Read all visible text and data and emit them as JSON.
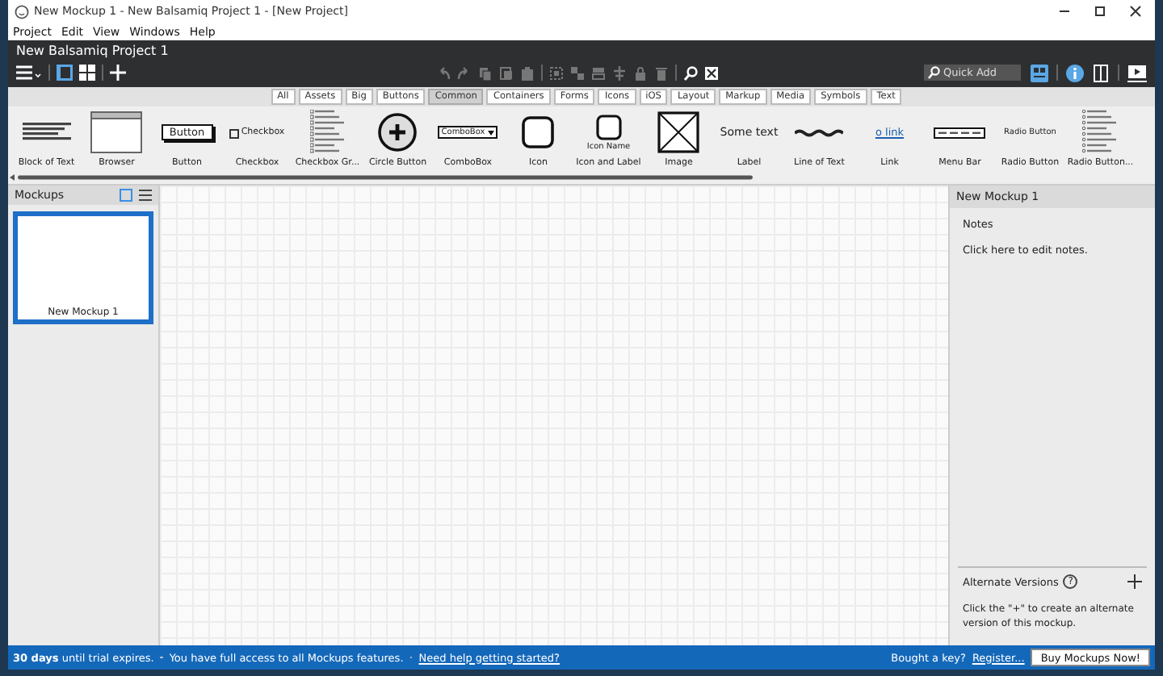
{
  "window": {
    "title": "New Mockup 1 - New Balsamiq Project 1 - [New Project]"
  },
  "menu": [
    "Project",
    "Edit",
    "View",
    "Windows",
    "Help"
  ],
  "project_title": "New Balsamiq Project 1",
  "quick_add": {
    "placeholder": "Quick Add"
  },
  "filter_tabs": [
    {
      "label": "All",
      "selected": false
    },
    {
      "label": "Assets",
      "selected": false
    },
    {
      "label": "Big",
      "selected": false
    },
    {
      "label": "Buttons",
      "selected": false
    },
    {
      "label": "Common",
      "selected": true
    },
    {
      "label": "Containers",
      "selected": false
    },
    {
      "label": "Forms",
      "selected": false
    },
    {
      "label": "Icons",
      "selected": false
    },
    {
      "label": "iOS",
      "selected": false
    },
    {
      "label": "Layout",
      "selected": false
    },
    {
      "label": "Markup",
      "selected": false
    },
    {
      "label": "Media",
      "selected": false
    },
    {
      "label": "Symbols",
      "selected": false
    },
    {
      "label": "Text",
      "selected": false
    }
  ],
  "components": [
    {
      "kind": "text-block",
      "label": "Block of Text"
    },
    {
      "kind": "browser",
      "label": "Browser"
    },
    {
      "kind": "button",
      "label": "Button",
      "preview": "Button"
    },
    {
      "kind": "checkbox",
      "label": "Checkbox",
      "preview": "Checkbox"
    },
    {
      "kind": "checkbox-group",
      "label": "Checkbox Gr..."
    },
    {
      "kind": "circle-button",
      "label": "Circle Button"
    },
    {
      "kind": "combobox",
      "label": "ComboBox",
      "preview": "ComboBox"
    },
    {
      "kind": "icon",
      "label": "Icon"
    },
    {
      "kind": "icon-label",
      "label": "Icon and Label",
      "preview": "Icon Name"
    },
    {
      "kind": "image",
      "label": "Image"
    },
    {
      "kind": "label",
      "label": "Label",
      "preview": "Some text"
    },
    {
      "kind": "line-of-text",
      "label": "Line of Text"
    },
    {
      "kind": "link",
      "label": "Link",
      "preview": "o link"
    },
    {
      "kind": "menu-bar",
      "label": "Menu Bar"
    },
    {
      "kind": "radio-button",
      "label": "Radio Button",
      "preview": "Radio Button"
    },
    {
      "kind": "radio-group",
      "label": "Radio Button..."
    }
  ],
  "mockups_panel": {
    "title": "Mockups",
    "items": [
      {
        "name": "New Mockup 1",
        "selected": true
      }
    ]
  },
  "inspector": {
    "title": "New Mockup 1",
    "notes_label": "Notes",
    "notes_hint": "Click here to edit notes.",
    "alternates_title": "Alternate Versions",
    "help": "?",
    "alternates_text": "Click the \"+\" to create an alternate version of this mockup."
  },
  "status_bar": {
    "trial": "**30 days** until trial expires.",
    "access": "You have full access to all Mockups features.",
    "help_link": "Need help getting started?",
    "key_question": "Bought a key?",
    "register_link": "Register...",
    "buy_button": "Buy Mockups Now!"
  }
}
